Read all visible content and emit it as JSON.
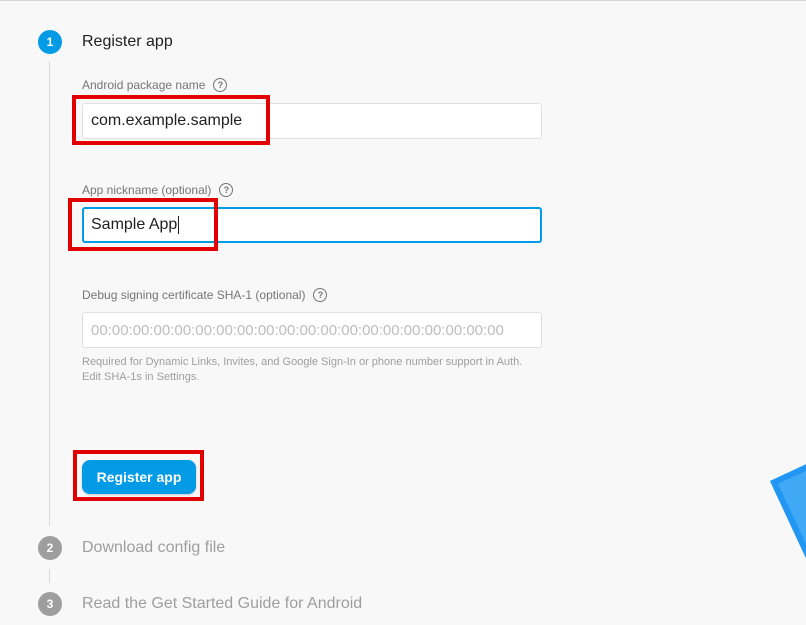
{
  "steps": [
    {
      "number": "1",
      "title": "Register app"
    },
    {
      "number": "2",
      "title": "Download config file"
    },
    {
      "number": "3",
      "title": "Read the Get Started Guide for Android"
    }
  ],
  "form": {
    "package_label": "Android package name",
    "package_value": "com.example.sample",
    "nickname_label": "App nickname (optional)",
    "nickname_value": "Sample App",
    "sha_label": "Debug signing certificate SHA-1 (optional)",
    "sha_placeholder": "00:00:00:00:00:00:00:00:00:00:00:00:00:00:00:00:00:00:00:00",
    "sha_hint": "Required for Dynamic Links, Invites, and Google Sign-In or phone number support in Auth. Edit SHA-1s in Settings.",
    "help_glyph": "?"
  },
  "actions": {
    "register_label": "Register app"
  },
  "colors": {
    "accent": "#039be5",
    "highlight": "#e00000",
    "inactive": "#9e9e9e"
  }
}
